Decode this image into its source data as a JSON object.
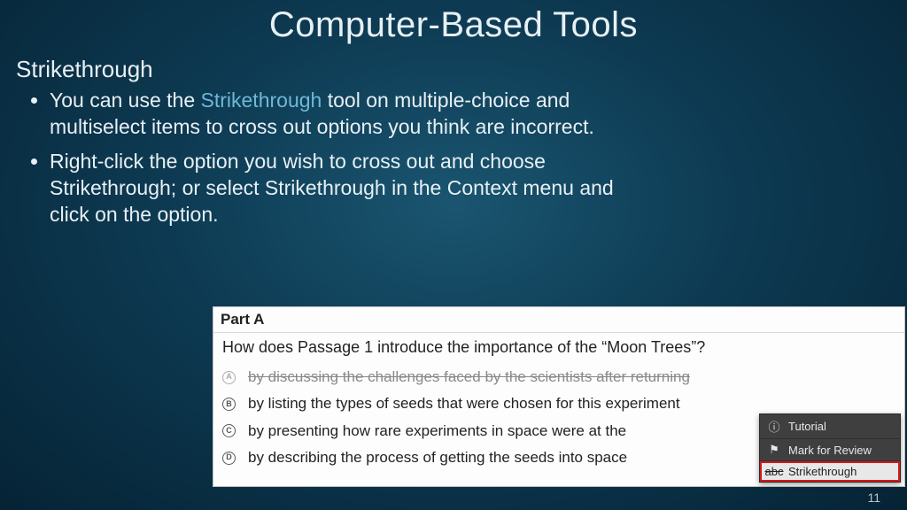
{
  "title": "Computer-Based Tools",
  "subtitle": "Strikethrough",
  "highlight_word": "Strikethrough",
  "bullets": [
    {
      "pre": "You can use the ",
      "hl": "Strikethrough",
      "post": " tool on multiple-choice and multiselect items to cross out options you think are incorrect."
    },
    {
      "pre": "Right-click the option you wish to cross out and choose Strikethrough; or select Strikethrough in the Context menu and click on the option.",
      "hl": "",
      "post": ""
    }
  ],
  "example": {
    "part_label": "Part A",
    "question": "How does Passage 1 introduce the importance of the “Moon Trees”?",
    "options": [
      {
        "letter": "A",
        "text": "by discussing the challenges faced by the scientists after returning",
        "struck": true
      },
      {
        "letter": "B",
        "text": "by listing the types of seeds that were chosen for this experiment",
        "struck": false
      },
      {
        "letter": "C",
        "text": "by presenting how rare experiments in space were at the",
        "struck": false
      },
      {
        "letter": "D",
        "text": "by describing the process of getting the seeds into space",
        "struck": false
      }
    ]
  },
  "context_menu": {
    "items": [
      {
        "icon": "info-icon",
        "label": "Tutorial"
      },
      {
        "icon": "flag-icon",
        "label": "Mark for Review"
      },
      {
        "icon": "strike-icon",
        "label": "Strikethrough"
      }
    ],
    "selected_index": 2
  },
  "page_number": "11"
}
